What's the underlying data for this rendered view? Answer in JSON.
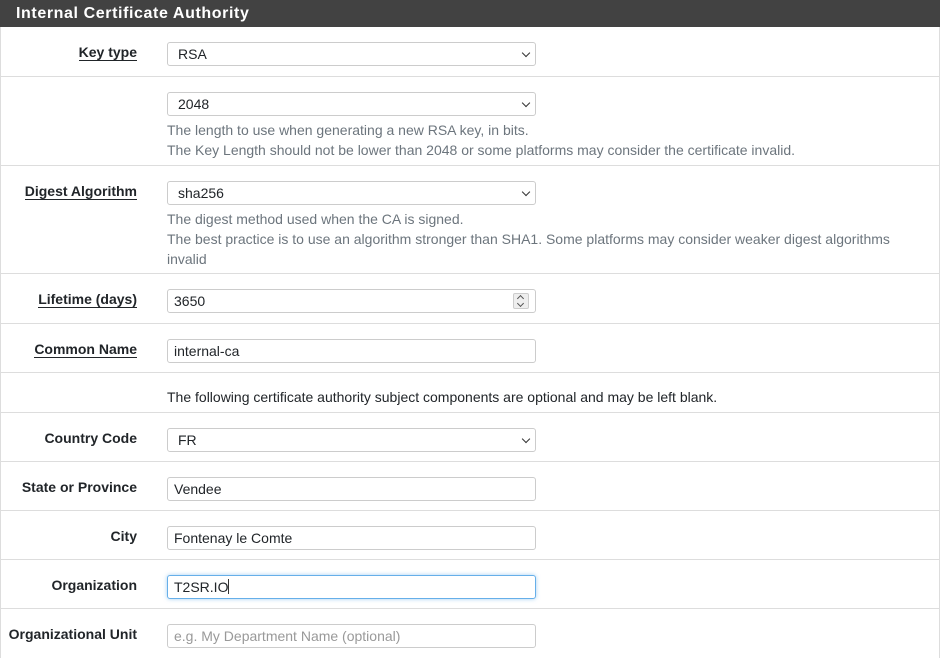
{
  "panel": {
    "title": "Internal Certificate Authority"
  },
  "key_type": {
    "label": "Key type",
    "value": "RSA"
  },
  "key_length": {
    "value": "2048",
    "help1": "The length to use when generating a new RSA key, in bits.",
    "help2": "The Key Length should not be lower than 2048 or some platforms may consider the certificate invalid."
  },
  "digest": {
    "label": "Digest Algorithm",
    "value": "sha256",
    "help1": "The digest method used when the CA is signed.",
    "help2": "The best practice is to use an algorithm stronger than SHA1. Some platforms may consider weaker digest algorithms invalid"
  },
  "lifetime": {
    "label": "Lifetime (days)",
    "value": "3650"
  },
  "common_name": {
    "label": "Common Name",
    "value": "internal-ca"
  },
  "optional_note": "The following certificate authority subject components are optional and may be left blank.",
  "country": {
    "label": "Country Code",
    "value": "FR"
  },
  "state": {
    "label": "State or Province",
    "value": "Vendee"
  },
  "city": {
    "label": "City",
    "value": "Fontenay le Comte"
  },
  "organization": {
    "label": "Organization",
    "value": "T2SR.IO"
  },
  "org_unit": {
    "label": "Organizational Unit",
    "placeholder": "e.g. My Department Name (optional)"
  }
}
